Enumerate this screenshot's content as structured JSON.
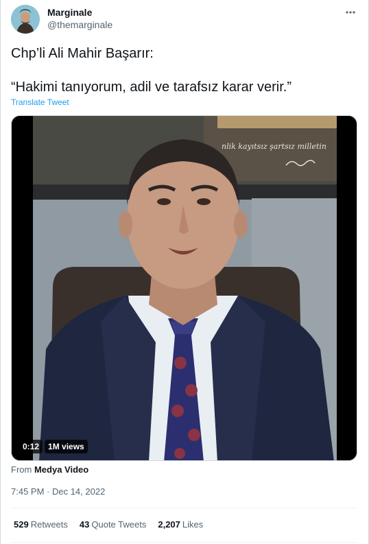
{
  "tweet": {
    "author": {
      "display_name": "Marginale",
      "handle": "@themarginale"
    },
    "text_line_1": "Chp’li Ali Mahir Başarır:",
    "text_line_2": "“Hakimi tanıyorum, adil ve tarafsız karar verir.”",
    "translate_label": "Translate Tweet",
    "media": {
      "duration": "0:12",
      "views": "1M views",
      "background_writing": "nlik kayıtsız şartsız milletin"
    },
    "source_prefix": "From",
    "source_name": "Medya Video",
    "timestamp": "7:45 PM · Dec 14, 2022",
    "stats": {
      "retweets_count": "529",
      "retweets_label": "Retweets",
      "quotes_count": "43",
      "quotes_label": "Quote Tweets",
      "likes_count": "2,207",
      "likes_label": "Likes"
    }
  },
  "colors": {
    "link": "#1d9bf0",
    "secondary_text": "#536471",
    "primary_text": "#0f1419"
  },
  "icons": {
    "more": "more-horizontal-icon"
  }
}
